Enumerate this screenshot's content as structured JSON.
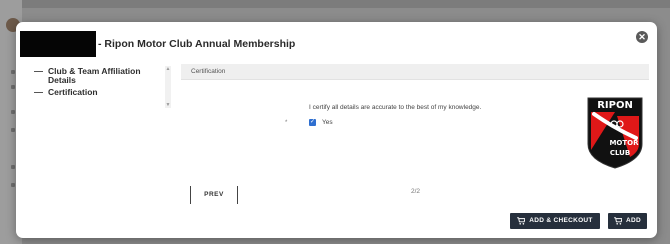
{
  "modal": {
    "title": "- Ripon Motor Club Annual Membership",
    "close_icon": "close-icon"
  },
  "steps": [
    {
      "label": "Club & Team Affiliation Details"
    },
    {
      "label": "Certification"
    }
  ],
  "certification": {
    "header": "Certification",
    "statement": "I certify all details are accurate to the best of my knowledge.",
    "required_marker": "*",
    "checkbox_label": "Yes",
    "checked": true
  },
  "logo": {
    "text_top": "RIPON",
    "text_bottom_1": "MOTOR",
    "text_bottom_2": "CLUB",
    "colors": {
      "black": "#111111",
      "red": "#e01818",
      "white": "#ffffff"
    }
  },
  "footer": {
    "prev_label": "PREV",
    "page_indicator": "2/2",
    "add_checkout_label": "ADD & CHECKOUT",
    "add_label": "ADD"
  },
  "colors": {
    "primary_button": "#262f3c",
    "checkbox": "#2f6fd0"
  }
}
